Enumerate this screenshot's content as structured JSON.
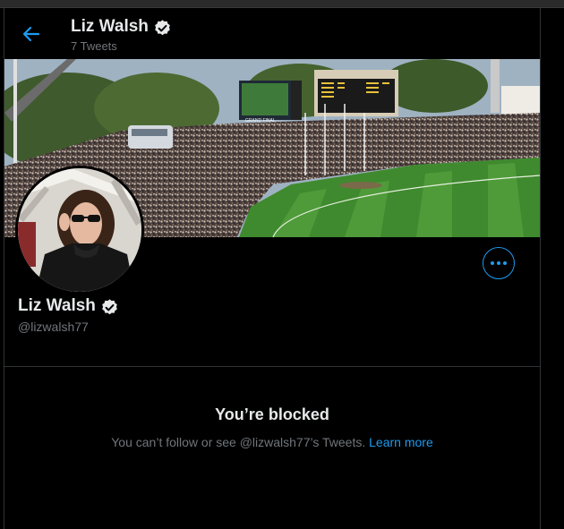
{
  "header": {
    "back_icon": "arrow-left-icon",
    "name": "Liz Walsh",
    "verified_icon": "verified-badge-icon",
    "subtitle": "7 Tweets"
  },
  "profile": {
    "name": "Liz Walsh",
    "handle": "@lizwalsh77",
    "more_icon": "more-horizontal-icon"
  },
  "banner": {
    "scoreboard_text": "GRAND FINAL"
  },
  "blocked": {
    "title": "You’re blocked",
    "message": "You can’t follow or see @lizwalsh77’s Tweets.",
    "link_label": "Learn more"
  },
  "colors": {
    "background": "#000000",
    "accent": "#1d9bf0",
    "text_primary": "#e7e9ea",
    "text_secondary": "#71767b",
    "border": "#2f3336"
  }
}
